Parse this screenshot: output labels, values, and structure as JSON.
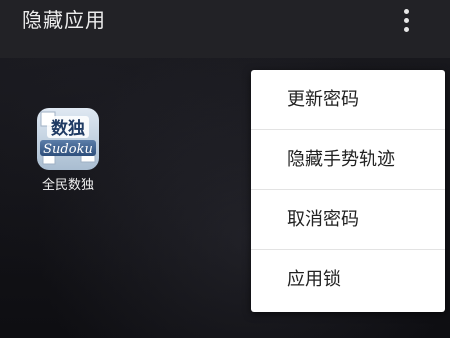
{
  "appbar": {
    "title": "隐藏应用",
    "overflow_icon": "more-vertical-icon"
  },
  "apps": [
    {
      "label": "全民数独",
      "icon": "sudoku-app-icon",
      "icon_text": "数独 Sudoku"
    }
  ],
  "menu": {
    "items": [
      {
        "label": "更新密码"
      },
      {
        "label": "隐藏手势轨迹"
      },
      {
        "label": "取消密码"
      },
      {
        "label": "应用锁"
      }
    ]
  },
  "colors": {
    "appbar": "#222226",
    "background": "#121216",
    "menu_bg": "#ffffff",
    "menu_text": "#222222"
  }
}
